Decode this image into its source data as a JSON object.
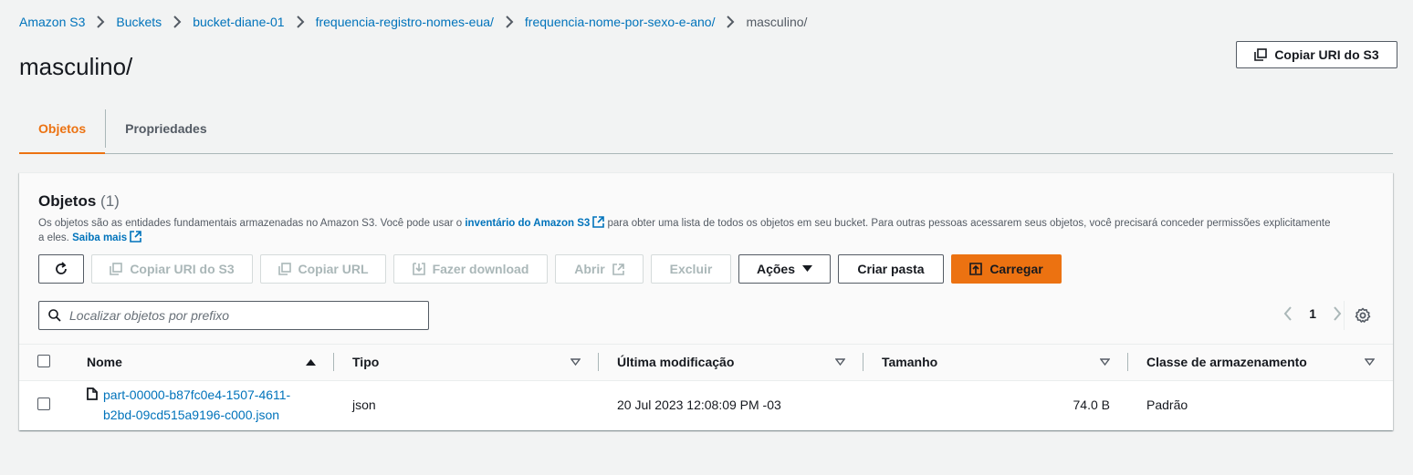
{
  "breadcrumb": [
    "Amazon S3",
    "Buckets",
    "bucket-diane-01",
    "frequencia-registro-nomes-eua/",
    "frequencia-nome-por-sexo-e-ano/",
    "masculino/"
  ],
  "page_title": "masculino/",
  "header": {
    "copy_uri_label": "Copiar URI do S3"
  },
  "tabs": [
    {
      "label": "Objetos",
      "active": true
    },
    {
      "label": "Propriedades",
      "active": false
    }
  ],
  "objects_panel": {
    "title": "Objetos",
    "count": "(1)",
    "desc_before": "Os objetos são as entidades fundamentais armazenadas no Amazon S3. Você pode usar o ",
    "desc_link": "inventário do Amazon S3",
    "desc_after": " para obter uma lista de todos os objetos em seu bucket. Para outras pessoas acessarem seus objetos, você precisará conceder permissões explicitamente a eles. ",
    "learn_more": "Saiba mais"
  },
  "toolbar": {
    "copy_uri": "Copiar URI do S3",
    "copy_url": "Copiar URL",
    "download": "Fazer download",
    "open": "Abrir",
    "delete": "Excluir",
    "actions": "Ações",
    "create_folder": "Criar pasta",
    "upload": "Carregar"
  },
  "search": {
    "placeholder": "Localizar objetos por prefixo",
    "value": ""
  },
  "pagination": {
    "page": "1"
  },
  "table": {
    "columns": [
      "Nome",
      "Tipo",
      "Última modificação",
      "Tamanho",
      "Classe de armazenamento"
    ],
    "rows": [
      {
        "name_line1": "part-00000-b87fc0e4-1507-4611-",
        "name_line2": "b2bd-09cd515a9196-c000.json",
        "type": "json",
        "modified": "20 Jul 2023 12:08:09 PM -03",
        "size": "74.0 B",
        "storage_class": "Padrão"
      }
    ]
  },
  "colors": {
    "link": "#0073bb",
    "accent": "#ec7211",
    "text": "#16191f",
    "muted": "#545b64"
  }
}
